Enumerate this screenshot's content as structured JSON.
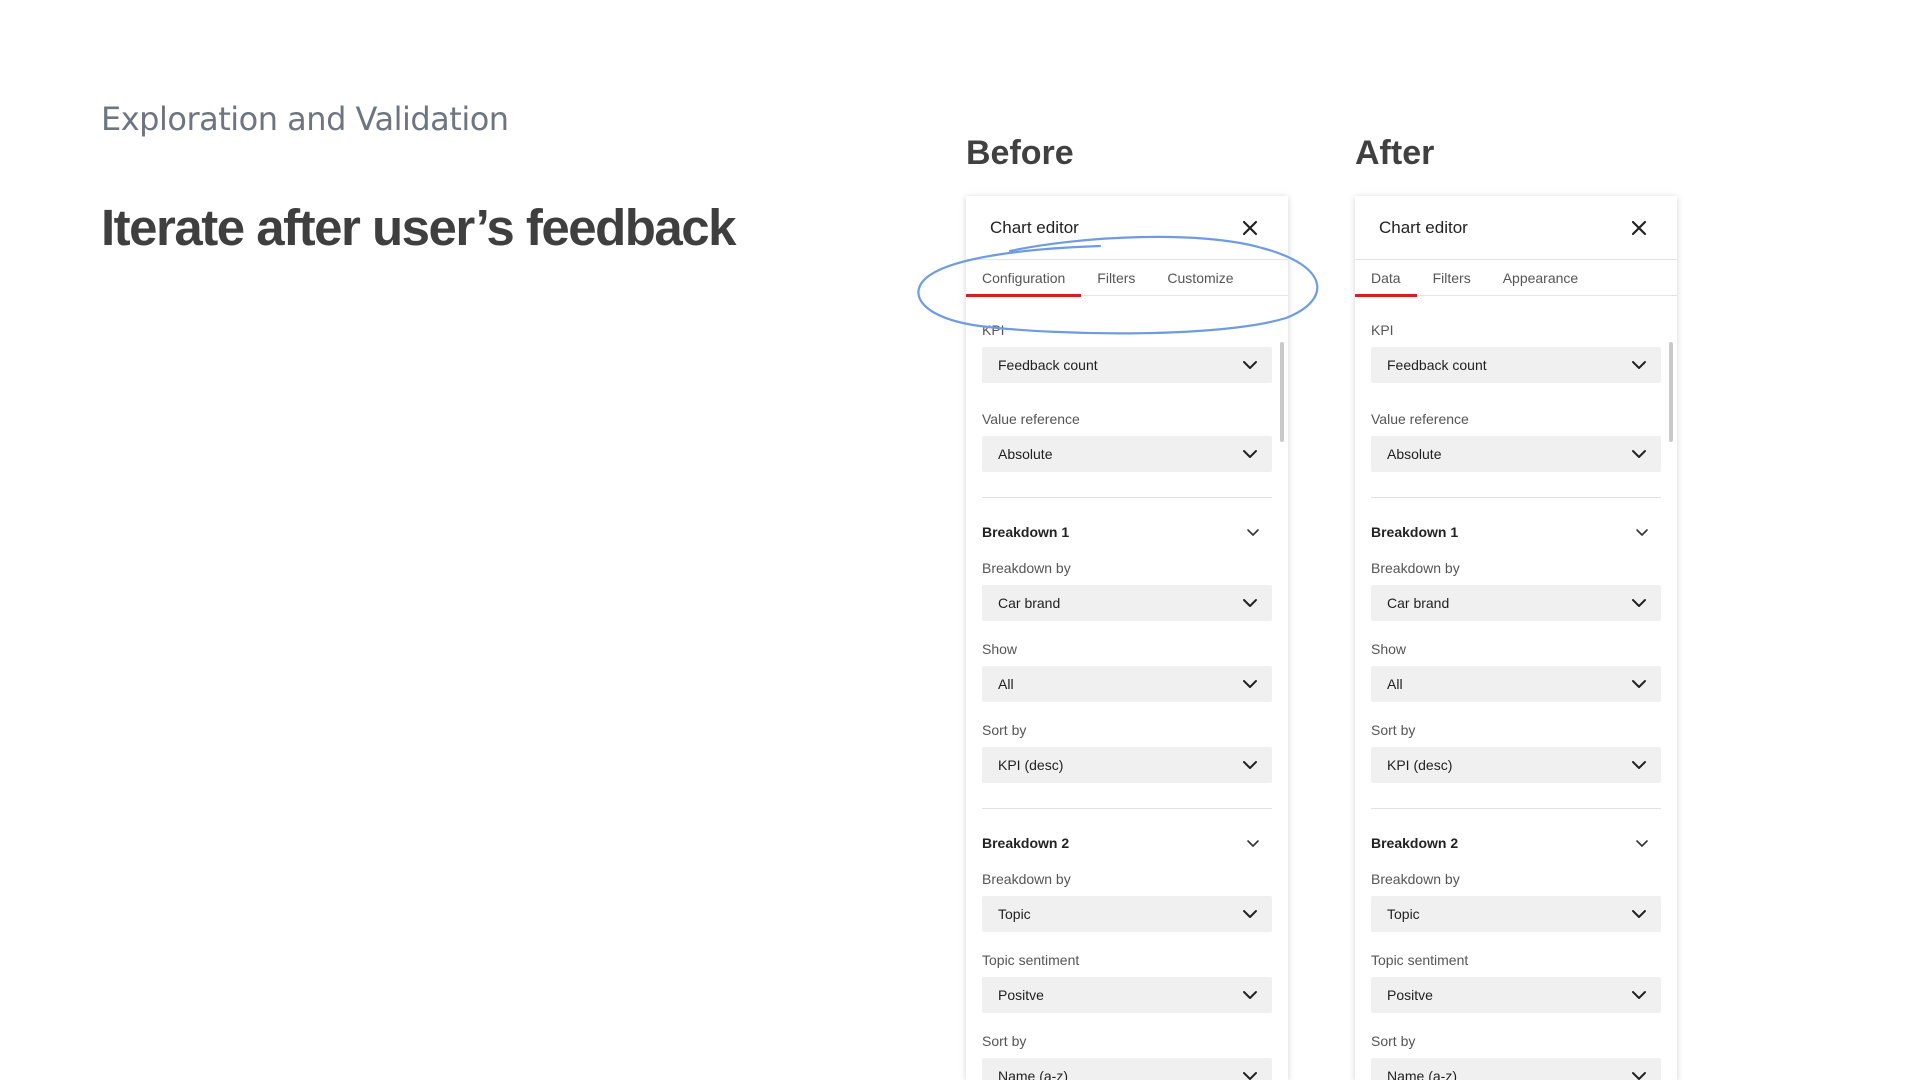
{
  "slide": {
    "eyebrow": "Exploration and Validation",
    "headline": "Iterate after user’s feedback",
    "before_label": "Before",
    "after_label": "After"
  },
  "before": {
    "title": "Chart editor",
    "tabs": [
      {
        "label": "Configuration",
        "active": true
      },
      {
        "label": "Filters",
        "active": false
      },
      {
        "label": "Customize",
        "active": false
      }
    ],
    "kpi_label": "KPI",
    "kpi_value": "Feedback count",
    "value_ref_label": "Value reference",
    "value_ref_value": "Absolute",
    "breakdown1": {
      "title": "Breakdown 1",
      "by_label": "Breakdown by",
      "by_value": "Car brand",
      "show_label": "Show",
      "show_value": "All",
      "sort_label": "Sort by",
      "sort_value": "KPI (desc)"
    },
    "breakdown2": {
      "title": "Breakdown 2",
      "by_label": "Breakdown by",
      "by_value": "Topic",
      "sentiment_label": "Topic sentiment",
      "sentiment_value": "Positve",
      "sort_label": "Sort by",
      "sort_value": "Name (a-z)"
    }
  },
  "after": {
    "title": "Chart editor",
    "tabs": [
      {
        "label": "Data",
        "active": true
      },
      {
        "label": "Filters",
        "active": false
      },
      {
        "label": "Appearance",
        "active": false
      }
    ],
    "kpi_label": "KPI",
    "kpi_value": "Feedback count",
    "value_ref_label": "Value reference",
    "value_ref_value": "Absolute",
    "breakdown1": {
      "title": "Breakdown 1",
      "by_label": "Breakdown by",
      "by_value": "Car brand",
      "show_label": "Show",
      "show_value": "All",
      "sort_label": "Sort by",
      "sort_value": "KPI (desc)"
    },
    "breakdown2": {
      "title": "Breakdown 2",
      "by_label": "Breakdown by",
      "by_value": "Topic",
      "sentiment_label": "Topic sentiment",
      "sentiment_value": "Positve",
      "sort_label": "Sort by",
      "sort_value": "Name (a-z)"
    }
  },
  "colors": {
    "active_tab_underline": "#d81e1e",
    "annotation_stroke": "#6f9be6"
  },
  "icons": {
    "close": "close-icon",
    "dropdown": "chevron-down-icon"
  }
}
